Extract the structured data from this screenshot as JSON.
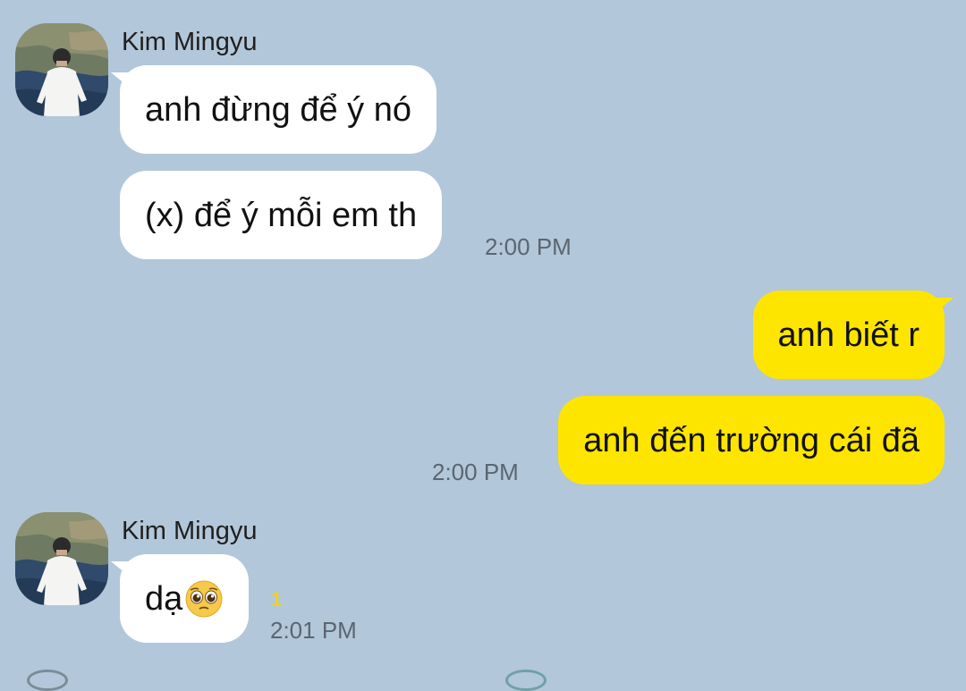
{
  "conversation": {
    "theme": {
      "background": "#b2c7d9",
      "incoming_bubble": "#ffffff",
      "outgoing_bubble": "#fee500",
      "time_text": "#5a6672",
      "unread_count": "#f1d317"
    },
    "group1": {
      "sender": "Kim Mingyu",
      "avatar_icon": "profile-photo-icon",
      "messages": [
        {
          "text": "anh đừng để ý nó"
        },
        {
          "text": "(x) để ý mỗi em th"
        }
      ],
      "time": "2:00 PM"
    },
    "group2": {
      "messages": [
        {
          "text": "anh biết r"
        },
        {
          "text": "anh đến trường cái đã"
        }
      ],
      "time": "2:00 PM"
    },
    "group3": {
      "sender": "Kim Mingyu",
      "avatar_icon": "profile-photo-icon",
      "messages": [
        {
          "text": "dạ",
          "emoji": "pleading-face-emoji"
        }
      ],
      "unread": "1",
      "time": "2:01 PM"
    }
  }
}
